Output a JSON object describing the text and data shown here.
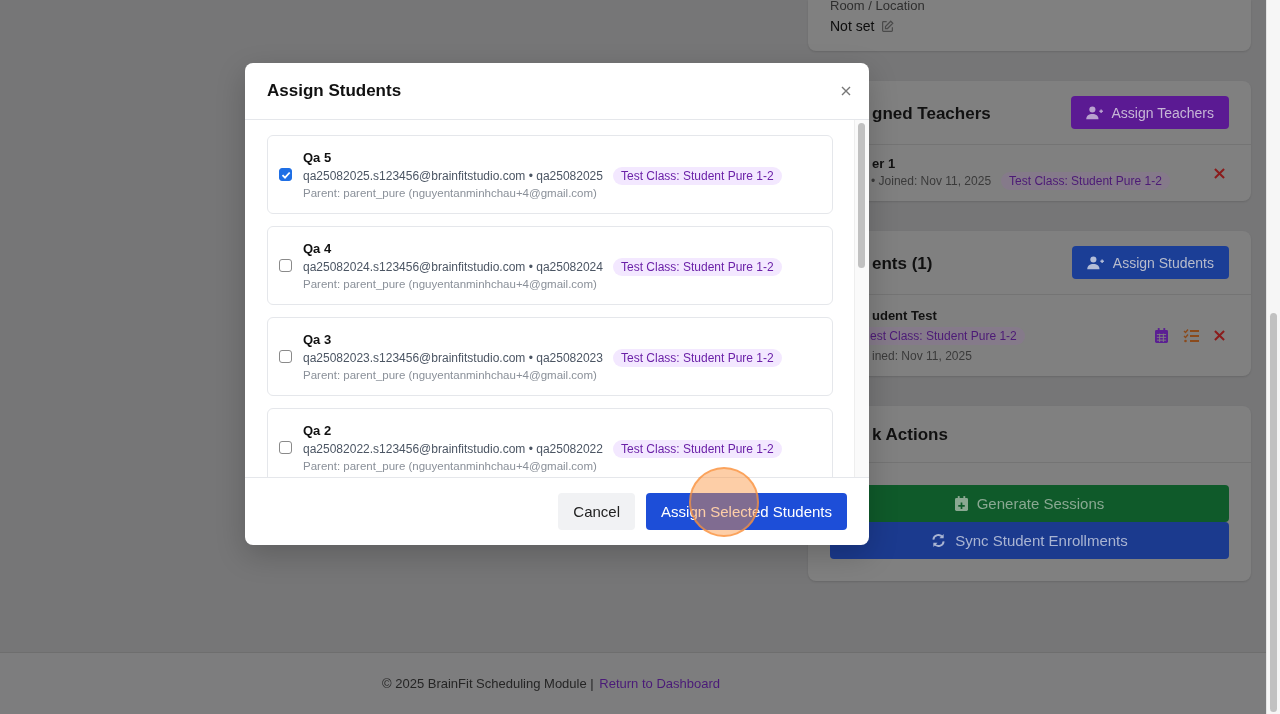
{
  "background": {
    "room": {
      "label": "Room / Location",
      "value": "Not set"
    },
    "teachers": {
      "title": "gned Teachers",
      "button": "Assign Teachers",
      "rows": [
        {
          "name": "er 1",
          "meta": "• Joined: Nov 11, 2025",
          "tag": "Test Class: Student Pure 1-2"
        }
      ]
    },
    "students": {
      "title": "ents (1)",
      "button": "Assign Students",
      "rows": [
        {
          "name": "udent Test",
          "tag": "est Class: Student Pure 1-2",
          "joined": "ined: Nov 11, 2025"
        }
      ]
    },
    "quick_actions": {
      "title": "k Actions",
      "buttons": [
        {
          "label": "Generate Sessions",
          "kind": "generate"
        },
        {
          "label": "Sync Student Enrollments",
          "kind": "sync"
        }
      ]
    },
    "footer": {
      "text": "© 2025 BrainFit Scheduling Module |",
      "link": "Return to Dashboard"
    }
  },
  "modal": {
    "title": "Assign Students",
    "students": [
      {
        "name": "Qa 5",
        "email": "qa25082025.s123456@brainfitstudio.com • qa25082025",
        "tag": "Test Class: Student Pure 1-2",
        "parent": "Parent: parent_pure (nguyentanminhchau+4@gmail.com)",
        "checked": true
      },
      {
        "name": "Qa 4",
        "email": "qa25082024.s123456@brainfitstudio.com • qa25082024",
        "tag": "Test Class: Student Pure 1-2",
        "parent": "Parent: parent_pure (nguyentanminhchau+4@gmail.com)",
        "checked": false
      },
      {
        "name": "Qa 3",
        "email": "qa25082023.s123456@brainfitstudio.com • qa25082023",
        "tag": "Test Class: Student Pure 1-2",
        "parent": "Parent: parent_pure (nguyentanminhchau+4@gmail.com)",
        "checked": false
      },
      {
        "name": "Qa 2",
        "email": "qa25082022.s123456@brainfitstudio.com • qa25082022",
        "tag": "Test Class: Student Pure 1-2",
        "parent": "Parent: parent_pure (nguyentanminhchau+4@gmail.com)",
        "checked": false
      }
    ],
    "buttons": {
      "cancel": "Cancel",
      "confirm": "Assign Selected Students"
    }
  }
}
